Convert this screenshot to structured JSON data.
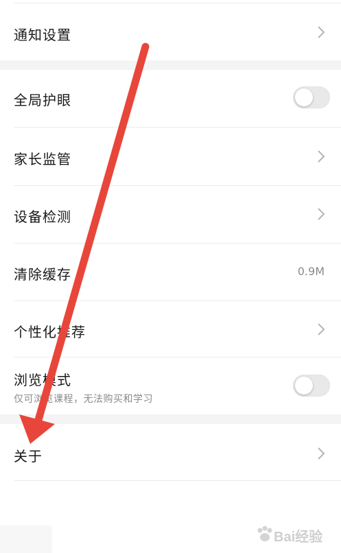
{
  "settings": {
    "notify": {
      "label": "通知设置"
    },
    "eye_care": {
      "label": "全局护眼",
      "enabled": false
    },
    "parental": {
      "label": "家长监管"
    },
    "device_check": {
      "label": "设备检测"
    },
    "clear_cache": {
      "label": "清除缓存",
      "value": "0.9M"
    },
    "personalized": {
      "label": "个性化推荐"
    },
    "browse_mode": {
      "label": "浏览模式",
      "subtitle": "仅可浏览课程，无法购买和学习",
      "enabled": false
    },
    "about": {
      "label": "关于"
    }
  },
  "icons": {
    "chevron": "chevron-right-icon",
    "annotation": "red-arrow-annotation"
  },
  "colors": {
    "arrow": "#e8463b",
    "divider": "#ececec",
    "section_gap": "#f4f4f4",
    "secondary_text": "#8a8a8a"
  },
  "watermark": {
    "text": "Bai经验"
  }
}
